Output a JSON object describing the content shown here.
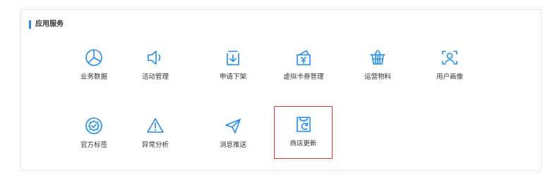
{
  "section": {
    "title": "应用服务"
  },
  "services": [
    {
      "label": "业务数据",
      "icon": "pie-chart-icon"
    },
    {
      "label": "活动管理",
      "icon": "speaker-icon"
    },
    {
      "label": "申请下架",
      "icon": "download-box-icon"
    },
    {
      "label": "虚拟卡券管理",
      "icon": "yuan-voucher-icon"
    },
    {
      "label": "运营物料",
      "icon": "basket-icon"
    },
    {
      "label": "用户画像",
      "icon": "user-scan-icon"
    },
    {
      "label": "官方标签",
      "icon": "badge-check-icon"
    },
    {
      "label": "异常分析",
      "icon": "warning-icon"
    },
    {
      "label": "消息推送",
      "icon": "send-icon"
    },
    {
      "label": "商店更新",
      "icon": "store-refresh-icon"
    }
  ],
  "colors": {
    "accent": "#1f8ef1",
    "highlight_border": "#d9353b",
    "text": "#333333",
    "panel_border": "#e6e6e6"
  }
}
